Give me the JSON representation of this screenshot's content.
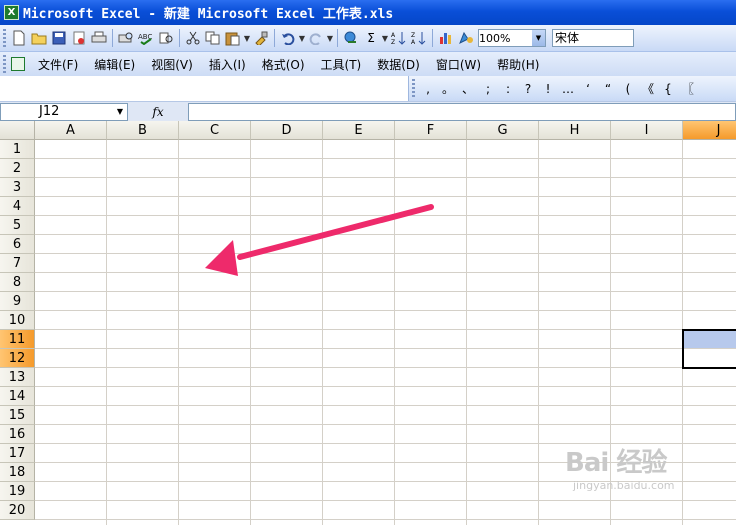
{
  "window": {
    "title": "Microsoft Excel - 新建 Microsoft Excel 工作表.xls",
    "app_icon_letter": "X"
  },
  "toolbar": {
    "zoom_value": "100%",
    "font_name": "宋体",
    "icons": [
      "new-icon",
      "open-icon",
      "save-icon",
      "permission-icon",
      "print-icon",
      "print-preview-icon",
      "spelling-icon",
      "research-icon",
      "cut-icon",
      "copy-icon",
      "paste-icon",
      "format-painter-icon",
      "undo-icon",
      "redo-icon",
      "hyperlink-icon",
      "autosum-icon",
      "sort-ascending-icon",
      "sort-descending-icon",
      "chart-wizard-icon",
      "drawing-icon"
    ]
  },
  "menubar": {
    "items": [
      {
        "label": "文件(F)"
      },
      {
        "label": "编辑(E)"
      },
      {
        "label": "视图(V)"
      },
      {
        "label": "插入(I)"
      },
      {
        "label": "格式(O)"
      },
      {
        "label": "工具(T)"
      },
      {
        "label": "数据(D)"
      },
      {
        "label": "窗口(W)"
      },
      {
        "label": "帮助(H)"
      }
    ]
  },
  "punctuation_toolbar": {
    "symbols": [
      ",",
      "。",
      "、",
      ";",
      ":",
      "?",
      "!",
      "…",
      "‘",
      "“",
      "(",
      "《",
      "{",
      "〖"
    ]
  },
  "formula_bar": {
    "name_box": "J12",
    "fx_label": "fx",
    "formula": ""
  },
  "sheet": {
    "columns": [
      "A",
      "B",
      "C",
      "D",
      "E",
      "F",
      "G",
      "H",
      "I",
      "J"
    ],
    "rows": [
      "1",
      "2",
      "3",
      "4",
      "5",
      "6",
      "7",
      "8",
      "9",
      "10",
      "11",
      "12",
      "13",
      "14",
      "15",
      "16",
      "17",
      "18",
      "19",
      "20"
    ],
    "selected_column": "J",
    "selected_rows": [
      "11",
      "12"
    ],
    "active_cell": "J12"
  },
  "annotation": {
    "arrow_color": "#ee2a6b"
  },
  "watermark": {
    "brand": "Bai 经验",
    "url": "jingyan.baidu.com"
  }
}
